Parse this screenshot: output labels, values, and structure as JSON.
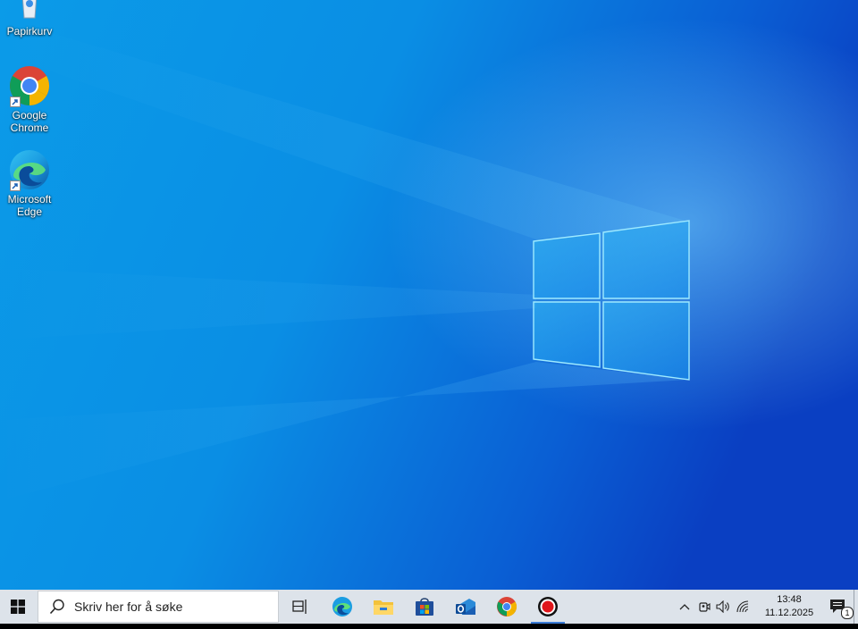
{
  "desktop": {
    "icons": [
      {
        "label": "Papirkurv",
        "icon": "recycle-bin-icon"
      },
      {
        "label": "Google Chrome",
        "icon": "chrome-icon",
        "shortcut": true
      },
      {
        "label": "Microsoft Edge",
        "icon": "edge-icon",
        "shortcut": true
      }
    ],
    "wallpaper": "windows-10-hero-wallpaper"
  },
  "taskbar": {
    "start_icon": "windows-logo-icon",
    "search": {
      "placeholder": "Skriv her for å søke",
      "icon": "search-icon"
    },
    "pinned": [
      {
        "name": "Task View",
        "icon": "task-view-icon"
      },
      {
        "name": "Microsoft Edge",
        "icon": "edge-icon"
      },
      {
        "name": "File Explorer",
        "icon": "folder-icon"
      },
      {
        "name": "Microsoft Store",
        "icon": "store-icon"
      },
      {
        "name": "Outlook",
        "icon": "outlook-icon"
      },
      {
        "name": "Google Chrome",
        "icon": "chrome-icon"
      },
      {
        "name": "Screen Recorder",
        "icon": "record-icon",
        "active": true
      }
    ],
    "tray": {
      "icons": [
        "chevron-up-icon",
        "meet-now-icon",
        "volume-icon",
        "network-icon"
      ],
      "time": "13:48",
      "date": "11.12.2025",
      "notification_count": "1"
    }
  },
  "colors": {
    "taskbar_bg": "#dde3ea",
    "wallpaper_deep": "#0a46c8",
    "wallpaper_light": "#12a8ee",
    "active_indicator": "#3a7bd5"
  }
}
